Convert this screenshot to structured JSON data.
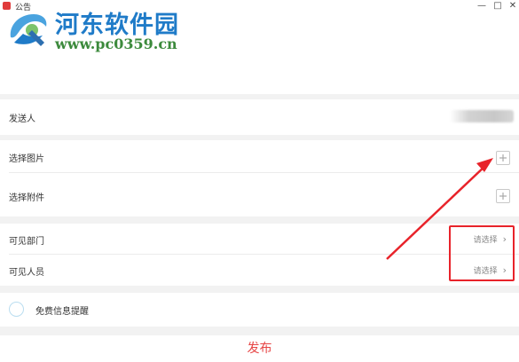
{
  "window": {
    "title": "公告",
    "minimize": "—",
    "maximize": "□",
    "close": "✕"
  },
  "watermark": {
    "title": "河东软件园",
    "url": "www.pc0359.cn"
  },
  "form": {
    "sender_label": "发送人",
    "select_image_label": "选择图片",
    "select_attachment_label": "选择附件",
    "visible_department_label": "可见部门",
    "visible_department_value": "请选择",
    "visible_people_label": "可见人员",
    "visible_people_value": "请选择",
    "free_notify_label": "免费信息提醒",
    "publish_label": "发布"
  },
  "icons": {
    "add_image": "plus-icon",
    "add_attachment": "plus-icon",
    "chevron": "chevron-right-icon"
  },
  "colors": {
    "accent_red": "#e64545",
    "annotation_red": "#e8232a",
    "watermark_blue": "#1f7bc8",
    "watermark_green": "#3c8a3c"
  }
}
